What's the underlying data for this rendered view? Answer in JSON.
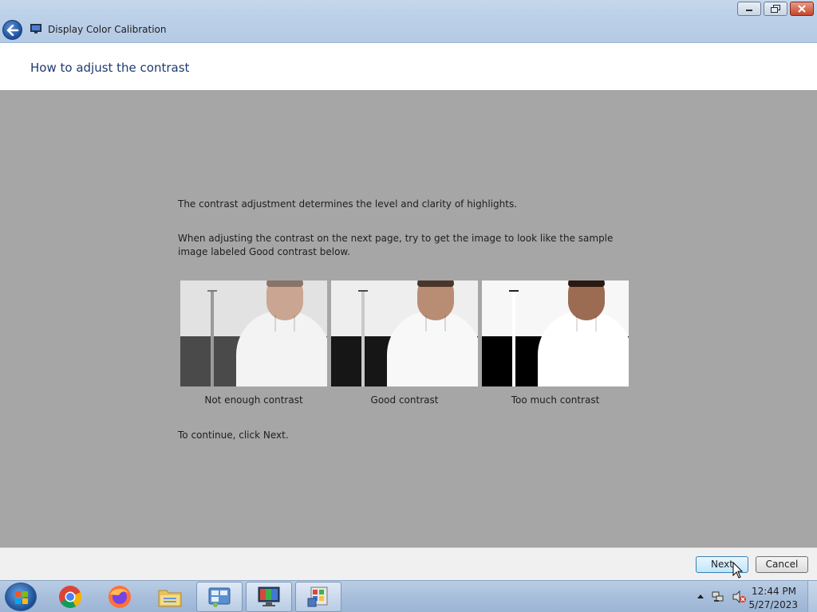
{
  "window": {
    "app_title": "Display Color Calibration",
    "page_title": "How to adjust the contrast"
  },
  "content": {
    "intro": "The contrast adjustment determines the level and clarity of highlights.",
    "instruction": "When adjusting the contrast on the next page, try to get the image to look like the sample image labeled Good contrast below.",
    "continue_text": "To continue, click Next.",
    "samples": [
      {
        "caption": "Not enough contrast"
      },
      {
        "caption": "Good contrast"
      },
      {
        "caption": "Too much contrast"
      }
    ]
  },
  "footer": {
    "next_label": "Next",
    "cancel_label": "Cancel"
  },
  "taskbar": {
    "items": [
      "start-button",
      "chrome-icon",
      "firefox-icon",
      "file-explorer-icon",
      "control-panel-icon",
      "display-calibration-icon",
      "color-management-icon"
    ],
    "time": "12:44 PM",
    "date": "5/27/2023"
  },
  "colors": {
    "content_bg": "#a6a6a6",
    "title_color": "#1e3a6e",
    "taskbar": "#a8bfdc"
  }
}
